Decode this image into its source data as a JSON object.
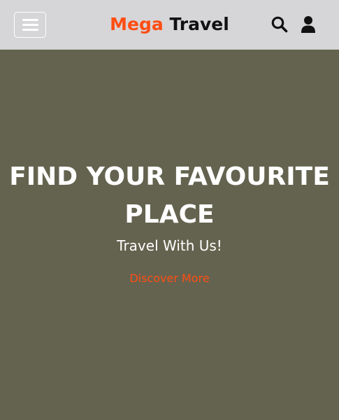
{
  "header": {
    "brand_first": "Mega",
    "brand_second": "Travel",
    "menu_icon": "hamburger-menu-icon",
    "search_icon": "search-icon",
    "user_icon": "user-icon"
  },
  "hero": {
    "title": "FIND YOUR FAVOURITE PLACE",
    "subtitle": "Travel With Us!",
    "cta": "Discover More"
  },
  "colors": {
    "accent": "#ff4e14",
    "header_bg": "#d6d5d7",
    "hero_bg": "#64634f",
    "text_light": "#ffffff",
    "text_dark": "#111111"
  }
}
